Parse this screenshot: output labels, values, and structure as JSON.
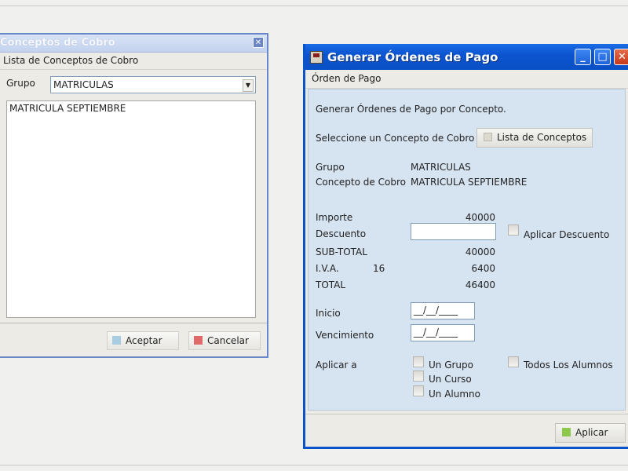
{
  "left_window": {
    "title": "Conceptos de Cobro",
    "close_glyph": "✕",
    "menu": "Lista de Conceptos de Cobro",
    "grupo_label": "Grupo",
    "grupo_value": "MATRICULAS",
    "list_items": [
      "MATRICULA SEPTIEMBRE"
    ],
    "accept_label": "Aceptar",
    "cancel_label": "Cancelar",
    "accept_icon": "accept-icon",
    "cancel_icon": "cancel-icon"
  },
  "right_window": {
    "title": "Generar Órdenes de Pago",
    "menu": "Órden de Pago",
    "heading": "Generar Órdenes de Pago por Concepto.",
    "select_concept_label": "Seleccione un Concepto de Cobro",
    "list_button_label": "Lista de Conceptos",
    "grupo_label": "Grupo",
    "grupo_value": "MATRICULAS",
    "concepto_label": "Concepto de Cobro",
    "concepto_value": "MATRICULA SEPTIEMBRE",
    "importe_label": "Importe",
    "importe_value": "40000",
    "descuento_label": "Descuento",
    "descuento_value": "",
    "aplicar_descuento_label": "Aplicar Descuento",
    "subtotal_label": "SUB-TOTAL",
    "subtotal_value": "40000",
    "iva_label": "I.V.A.",
    "iva_rate": "16",
    "iva_value": "6400",
    "total_label": "TOTAL",
    "total_value": "46400",
    "inicio_label": "Inicio",
    "inicio_value": "__/__/____",
    "vencimiento_label": "Vencimiento",
    "vencimiento_value": "__/__/____",
    "aplicar_a_label": "Aplicar a",
    "options": [
      "Un Grupo",
      "Un Curso",
      "Un Alumno"
    ],
    "todos_label": "Todos Los Alumnos",
    "apply_button_label": "Aplicar",
    "minimize_glyph": "_",
    "maximize_glyph": "□",
    "close_glyph": "✕"
  },
  "colors": {
    "xp_blue": "#0a53c9",
    "panel_blue": "#d6e3f1",
    "accept_square": "#a8cce0",
    "cancel_square": "#e06a6a",
    "apply_square": "#8cc84b"
  }
}
